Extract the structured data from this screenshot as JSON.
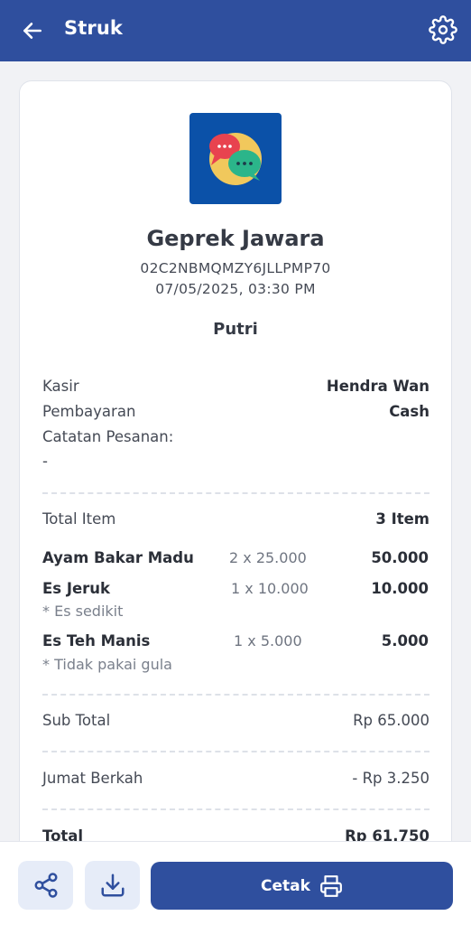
{
  "appbar": {
    "title": "Struk",
    "back_icon": "arrow-left-icon",
    "settings_icon": "gear-icon"
  },
  "store": {
    "name": "Geprek Jawara",
    "receipt_id": "02C2NBMQMZY6JLLPMP70",
    "datetime": "07/05/2025, 03:30 PM",
    "customer": "Putri",
    "logo_icon": "chat-bubbles-icon",
    "colors": {
      "logo_bg": "#0b51a8",
      "logo_circle": "#f1c85c",
      "bubble_red": "#e8434f",
      "bubble_green": "#2bb58a"
    }
  },
  "info": {
    "cashier_label": "Kasir",
    "cashier_value": "Hendra Wan",
    "payment_label": "Pembayaran",
    "payment_value": "Cash",
    "notes_label": "Catatan Pesanan:",
    "notes_value": "-"
  },
  "items_summary": {
    "label": "Total Item",
    "value": "3 Item"
  },
  "items": [
    {
      "name": "Ayam Bakar Madu",
      "qty": "2 x 25.000",
      "total": "50.000",
      "note": ""
    },
    {
      "name": "Es Jeruk",
      "qty": "1 x 10.000",
      "total": "10.000",
      "note": "* Es sedikit"
    },
    {
      "name": "Es Teh Manis",
      "qty": "1 x 5.000",
      "total": "5.000",
      "note": "* Tidak pakai gula"
    }
  ],
  "totals": {
    "subtotal_label": "Sub Total",
    "subtotal_value": "Rp 65.000",
    "discount_label": "Jumat Berkah",
    "discount_value": "- Rp 3.250",
    "total_label": "Total",
    "total_value": "Rp 61.750"
  },
  "actions": {
    "share_icon": "share-icon",
    "download_icon": "download-icon",
    "print_label": "Cetak",
    "print_icon": "printer-icon"
  },
  "theme": {
    "primary": "#2f4f9e",
    "button_light": "#e6ecf8"
  }
}
